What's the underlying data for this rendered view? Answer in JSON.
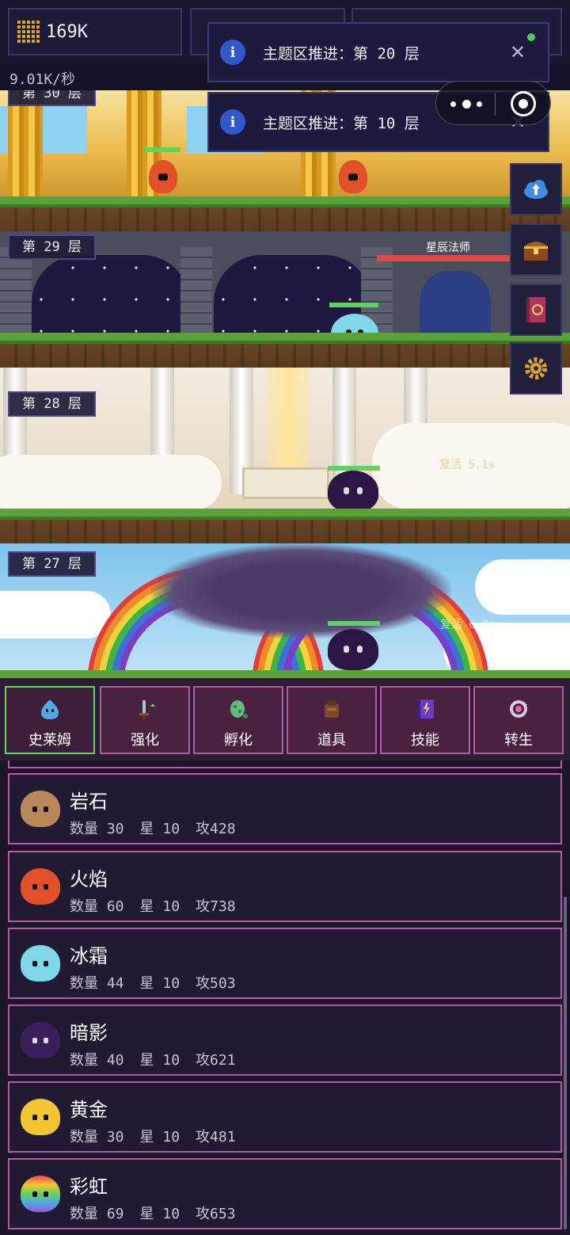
{
  "resources": {
    "gold": "169K",
    "rate": "9.01K/秒"
  },
  "toasts": [
    {
      "message": "主题区推进：第 20 层"
    },
    {
      "message": "主题区推进：第 10 层"
    }
  ],
  "floors": [
    {
      "label": "第 30 层"
    },
    {
      "label": "第 29 层",
      "enemy_name": "星辰法师"
    },
    {
      "label": "第 28 层",
      "faded_text": "复活 5.1s"
    },
    {
      "label": "第 27 层",
      "faded_text": "复活 6.0s",
      "counter": "10/10"
    }
  ],
  "tabs": [
    {
      "label": "史莱姆",
      "icon": "slime-icon",
      "active": true
    },
    {
      "label": "强化",
      "icon": "sword-upgrade-icon"
    },
    {
      "label": "孵化",
      "icon": "egg-icon"
    },
    {
      "label": "道具",
      "icon": "bag-icon"
    },
    {
      "label": "技能",
      "icon": "spellbook-icon"
    },
    {
      "label": "转生",
      "icon": "rebirth-icon"
    }
  ],
  "slimes": [
    {
      "name": "岩石",
      "count": "数量 30",
      "star": "星 10",
      "attack": "攻428",
      "color": "#b9875a"
    },
    {
      "name": "火焰",
      "count": "数量 60",
      "star": "星 10",
      "attack": "攻738",
      "color": "#e2502a"
    },
    {
      "name": "冰霜",
      "count": "数量 44",
      "star": "星 10",
      "attack": "攻503",
      "color": "#7fd8ea"
    },
    {
      "name": "暗影",
      "count": "数量 40",
      "star": "星 10",
      "attack": "攻621",
      "color": "#3a1f5a"
    },
    {
      "name": "黄金",
      "count": "数量 30",
      "star": "星 10",
      "attack": "攻481",
      "color": "#f2c630"
    },
    {
      "name": "彩虹",
      "count": "数量 69",
      "star": "星 10",
      "attack": "攻653",
      "color": "#d86ad0"
    }
  ],
  "side_buttons": [
    "cloud-up-icon",
    "treasure-chest-icon",
    "magic-book-icon",
    "gear-icon"
  ]
}
